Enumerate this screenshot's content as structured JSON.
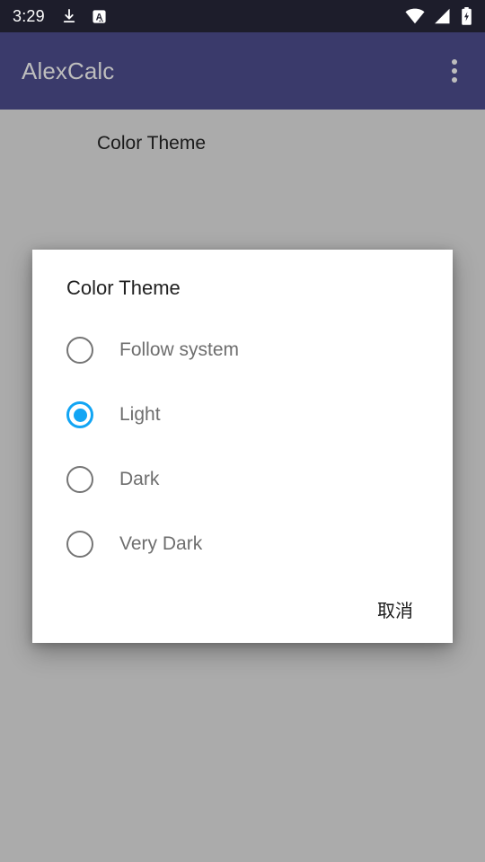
{
  "status_bar": {
    "time": "3:29",
    "left_icons": [
      {
        "name": "download-icon"
      },
      {
        "name": "text-input-a-icon"
      }
    ],
    "right_icons": [
      {
        "name": "wifi-icon"
      },
      {
        "name": "cellular-signal-icon"
      },
      {
        "name": "battery-charging-icon"
      }
    ],
    "background_color": "#1d1d2b"
  },
  "app_bar": {
    "title": "AlexCalc",
    "background_color": "#3a3a6b",
    "title_color": "#bdbdbd",
    "overflow_menu_icon": "more-vert-icon"
  },
  "background": {
    "setting_label": "Color Theme",
    "scrim_color": "#ababab"
  },
  "dialog": {
    "title": "Color Theme",
    "options": [
      {
        "label": "Follow system",
        "selected": false
      },
      {
        "label": "Light",
        "selected": true
      },
      {
        "label": "Dark",
        "selected": false
      },
      {
        "label": "Very Dark",
        "selected": false
      }
    ],
    "cancel_label": "取消",
    "accent_color": "#12a5f4",
    "unselected_color": "#757575",
    "label_color": "#6e6e6e",
    "title_color": "#212121",
    "background_color": "#ffffff"
  }
}
